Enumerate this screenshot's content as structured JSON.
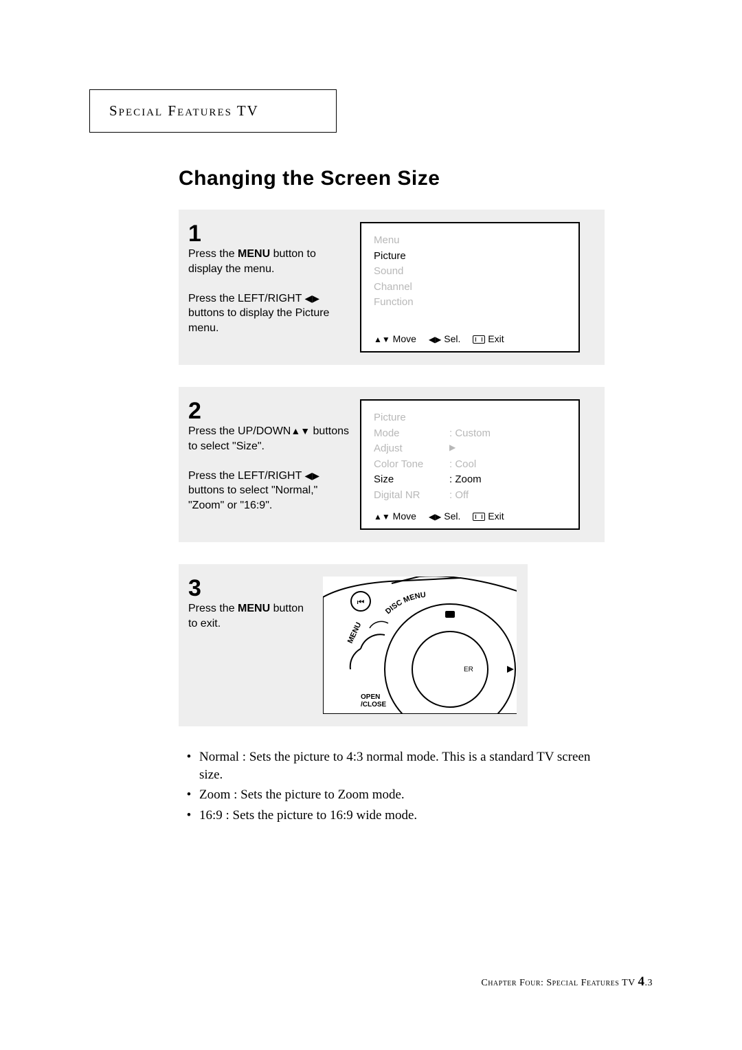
{
  "header": {
    "label": "Special Features TV"
  },
  "title": "Changing the Screen Size",
  "steps": {
    "s1": {
      "num": "1",
      "p1a": "Press the ",
      "p1bold": "MENU",
      "p1b": " button to display the menu.",
      "p2a": "Press the LEFT/RIGHT ",
      "p2arrows": "◀▶",
      "p2b": " buttons to display the Picture menu.",
      "osd": {
        "lines": [
          "Menu",
          "Picture",
          "Sound",
          "Channel",
          "Function"
        ],
        "selected": "Picture",
        "nav_move": "Move",
        "nav_sel": "Sel.",
        "nav_exit": "Exit"
      }
    },
    "s2": {
      "num": "2",
      "p1a": "Press the UP/DOWN",
      "p1arrows": "▲▼",
      "p1b": " buttons to select \"Size\".",
      "p2a": "Press the LEFT/RIGHT ",
      "p2arrows": "◀▶",
      "p2b": " buttons to select \"Normal,\" \"Zoom\" or \"16:9\".",
      "osd": {
        "title": "Picture",
        "rows": [
          {
            "k": "Mode",
            "v": ": Custom"
          },
          {
            "k": "Adjust",
            "v": "▶"
          },
          {
            "k": "Color Tone",
            "v": ": Cool"
          },
          {
            "k": "Size",
            "v": ": Zoom"
          },
          {
            "k": "Digital NR",
            "v": ": Off"
          }
        ],
        "selected": "Size",
        "nav_move": "Move",
        "nav_sel": "Sel.",
        "nav_exit": "Exit"
      }
    },
    "s3": {
      "num": "3",
      "p1a": "Press the ",
      "p1bold": "MENU",
      "p1b": " button to exit.",
      "remote": {
        "btn_disc_menu": "DISC MENU",
        "btn_menu": "MENU",
        "btn_open_close": "OPEN\n/CLOSE",
        "btn_enter": "ENTER",
        "btn_prev_icon": "prev-track-icon"
      }
    }
  },
  "bullets": [
    "Normal : Sets the picture to 4:3 normal mode. This is a standard TV screen size.",
    "Zoom : Sets the picture to Zoom mode.",
    "16:9 : Sets the picture to 16:9 wide mode."
  ],
  "footer": {
    "chapter": "Chapter Four: Special Features TV ",
    "page_major": "4",
    "page_minor": ".3"
  }
}
